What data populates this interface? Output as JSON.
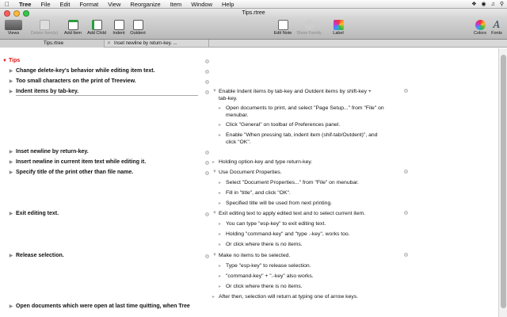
{
  "menubar": {
    "items": [
      "Tree",
      "File",
      "Edit",
      "Format",
      "View",
      "Reorganize",
      "Item",
      "Window",
      "Help"
    ]
  },
  "window": {
    "title": "Tips.rtree"
  },
  "toolbar": {
    "views": "Views",
    "delete": "Delete Item(s)",
    "add_item": "Add Item",
    "add_child": "Add Child",
    "indent": "Indent",
    "outdent": "Outdent",
    "edit_note": "Edit Note",
    "show_family": "Show Family",
    "label": "Label",
    "colors": "Colors",
    "fonts": "Fonts"
  },
  "tabs": [
    "Tips.rtree",
    "Inset newline by return-key. ..."
  ],
  "outline": {
    "root": "Tips",
    "items": [
      "Change delete-key's behavior while editing item text.",
      "Too small characters on the print of Treeview.",
      "Indent items by tab-key.",
      "Inset newline by return-key.",
      "Insert newline in current item text while editing it.",
      "Specify title of the print other than file name.",
      "Exit editing text.",
      "Release selection.",
      "Open documents which were open at last time quitting, when Tree"
    ],
    "notes": {
      "indent": [
        "Enable Indent items by tab-key and Outdent items by shift-key +",
        "tab-key.",
        "Open documents to print, and select \"Page Setup...\" from \"File\" on",
        "menubar.",
        "Click \"General\" on toolbar of Preferences panel.",
        "Enable \"When pressing tab, indent item (shif-tab/Outdent)\", and",
        "click \"OK\"."
      ],
      "newline": [
        "Holding option-key and type return-key."
      ],
      "title": [
        "Use Document Properties.",
        "Select \"Document Properties...\" from \"File\" on menubar.",
        "Fill in \"title\", and click \"OK\".",
        "Specified title will be used from next printing."
      ],
      "exit": [
        "Exit editing text to apply edited text and to select current item.",
        "You can type \"esp-key\" to exit editing text.",
        "Holding \"command-key\" and \"type .-key\", works too.",
        "Or click where there is no items."
      ],
      "release": [
        "Make no items to be selected.",
        "Type \"esp-key\" to release selection.",
        "\"command-key\" + \".-key\" also works.",
        "Or click where there is no items.",
        "After then, selection will return at typing one of arrow keys."
      ]
    }
  }
}
